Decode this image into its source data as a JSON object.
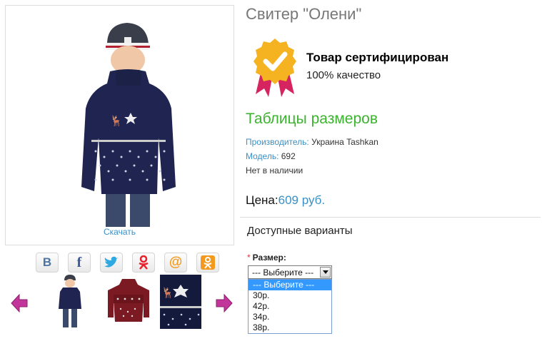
{
  "product": {
    "title": "Свитер \"Олени\"",
    "download_label": "Скачать",
    "certified_title": "Товар сертифицирован",
    "certified_sub": "100% качество",
    "size_table_link": "Таблицы размеров",
    "manufacturer_label": "Производитель:",
    "manufacturer_value": "Украина Tashkan",
    "model_label": "Модель:",
    "model_value": "692",
    "availability": "Нет в наличии",
    "price_label": "Цена:",
    "price_value": "609 руб."
  },
  "share": {
    "icons": [
      "vk-icon",
      "facebook-icon",
      "twitter-icon",
      "odnoklassniki-icon",
      "mail-ru-icon",
      "odnoklassniki-orange-icon"
    ],
    "labels": [
      "В",
      "f",
      "",
      "",
      "@",
      ""
    ]
  },
  "options": {
    "section_title": "Доступные варианты",
    "required_mark": "*",
    "size_label": "Размер:",
    "select_value": "--- Выберите ---",
    "items": [
      "--- Выберите ---",
      "30р.",
      "42р.",
      "34р.",
      "38р."
    ],
    "selected_index": 0
  },
  "colors": {
    "link": "#3a8fc5",
    "size_table": "#3bb32e",
    "highlight": "#3399ff",
    "sweater_navy": "#1f2450",
    "sweater_burgundy": "#7b1a22",
    "badge_gold": "#f5b321",
    "badge_ribbon": "#d62460",
    "arrow": "#c2359a"
  }
}
